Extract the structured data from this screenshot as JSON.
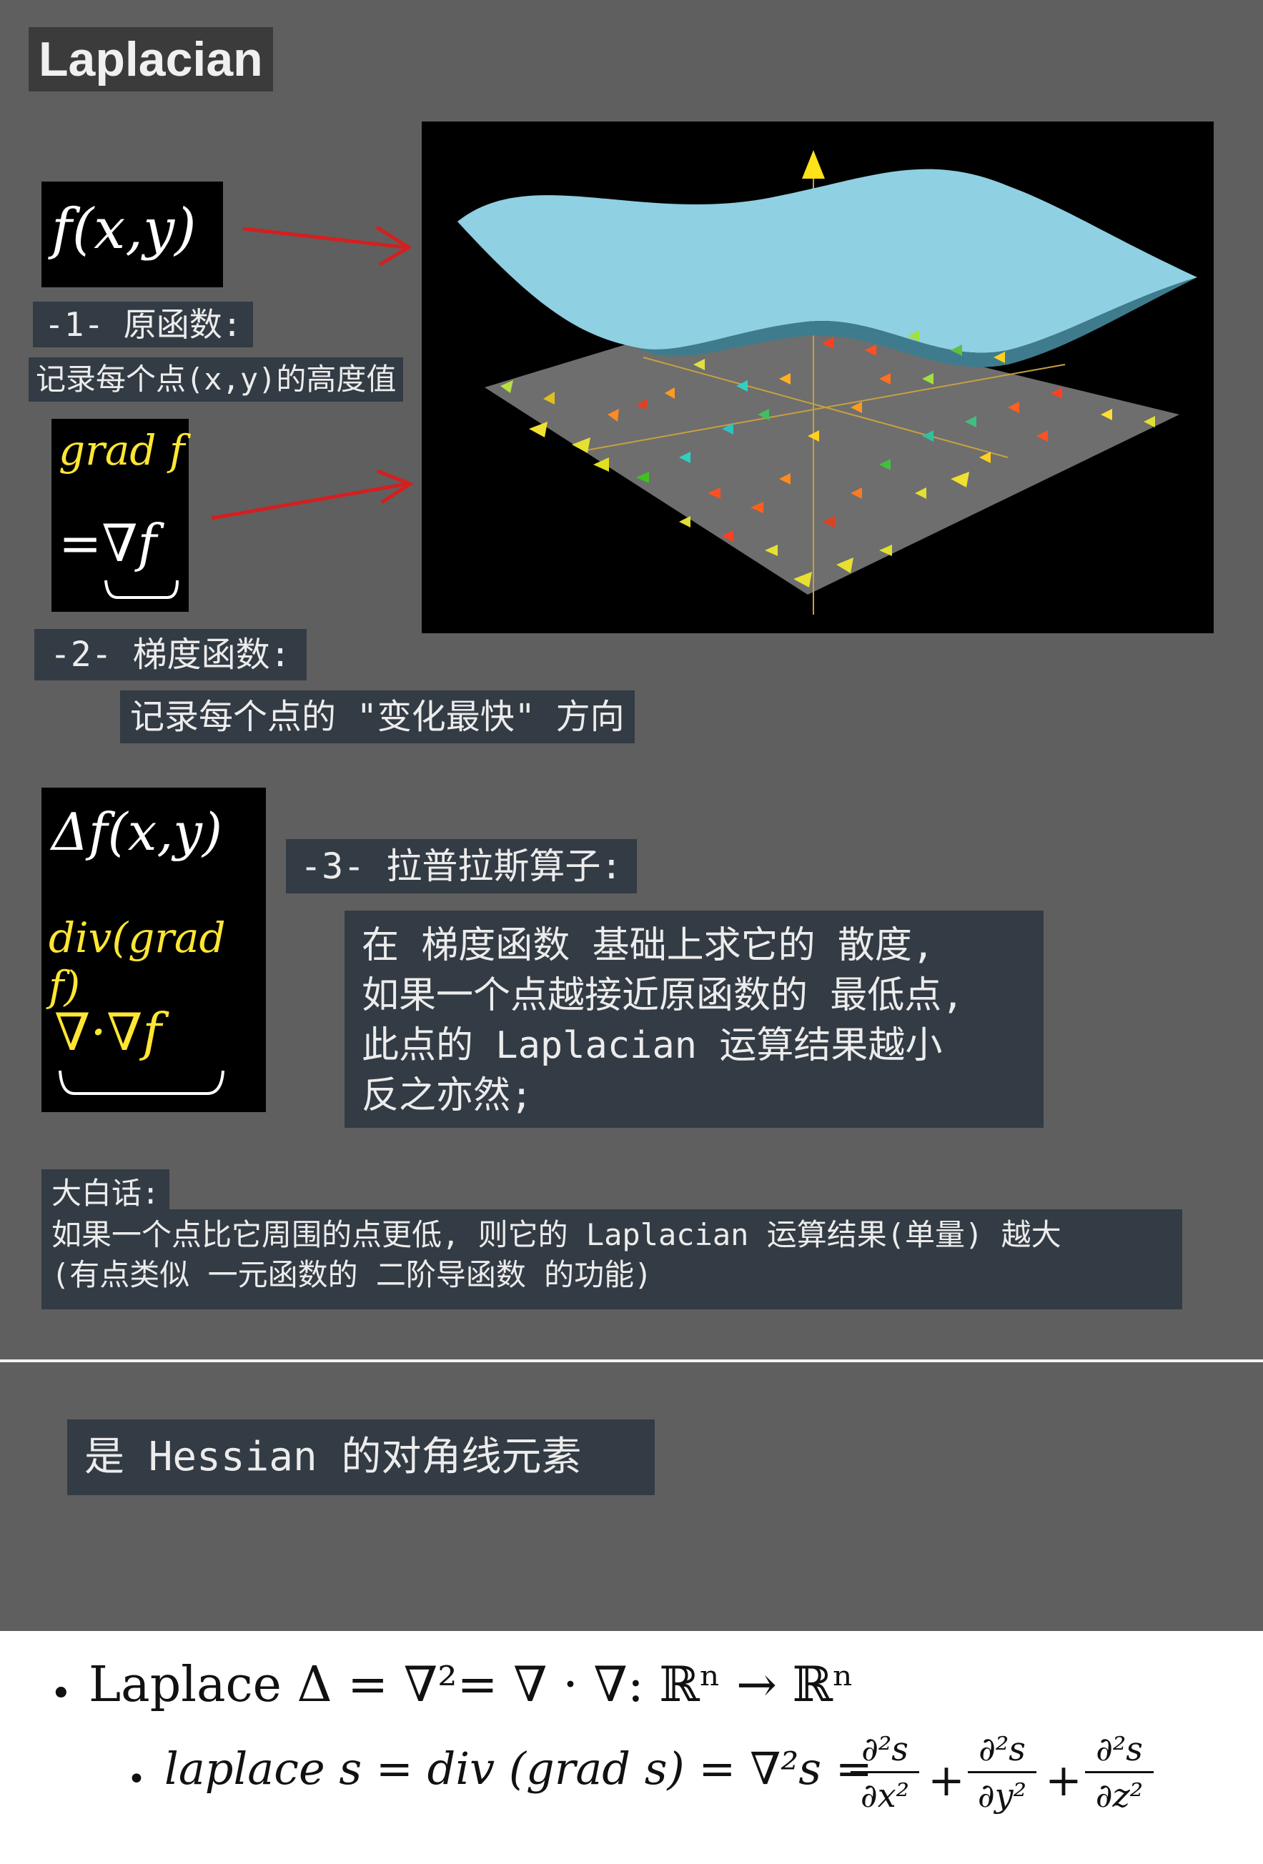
{
  "title": "Laplacian",
  "sec1": {
    "formula": "f(x,y)",
    "label": "-1- 原函数:",
    "desc": "记录每个点(x,y)的高度值"
  },
  "sec2": {
    "formula_line1": "grad f",
    "formula_line2": "=∇f",
    "label": "-2- 梯度函数:",
    "desc": "记录每个点的 \"变化最快\" 方向"
  },
  "sec3": {
    "formula_line1": "Δf(x,y)",
    "formula_line2": "div(grad f)",
    "formula_line3": "∇·∇f",
    "label": "-3- 拉普拉斯算子:",
    "desc_lines": [
      "在 梯度函数 基础上求它的 散度,",
      "如果一个点越接近原函数的 最低点,",
      "此点的 Laplacian 运算结果越小",
      "反之亦然;"
    ]
  },
  "plain": {
    "heading": "大白话:",
    "line1": "如果一个点比它周围的点更低, 则它的 Laplacian 运算结果(单量) 越大",
    "line2": "(有点类似 一元函数的 二阶导函数 的功能)"
  },
  "hessian_note": "是 Hessian 的对角线元素",
  "bullets": {
    "b1": "Laplace Δ = ∇²= ∇ · ∇: ℝⁿ → ℝⁿ",
    "b2_lhs": "laplace s = div (grad s) = ∇²s =",
    "frac_num": "∂²s",
    "frac_den_x": "∂x²",
    "frac_den_y": "∂y²",
    "frac_den_z": "∂z²",
    "plus": "+"
  },
  "colors": {
    "background": "#5f5f5f",
    "label_bg": "#333b44",
    "surface": "#8fd0e2",
    "arrow_red": "#d41f1f",
    "plane": "#6e6e6e"
  }
}
